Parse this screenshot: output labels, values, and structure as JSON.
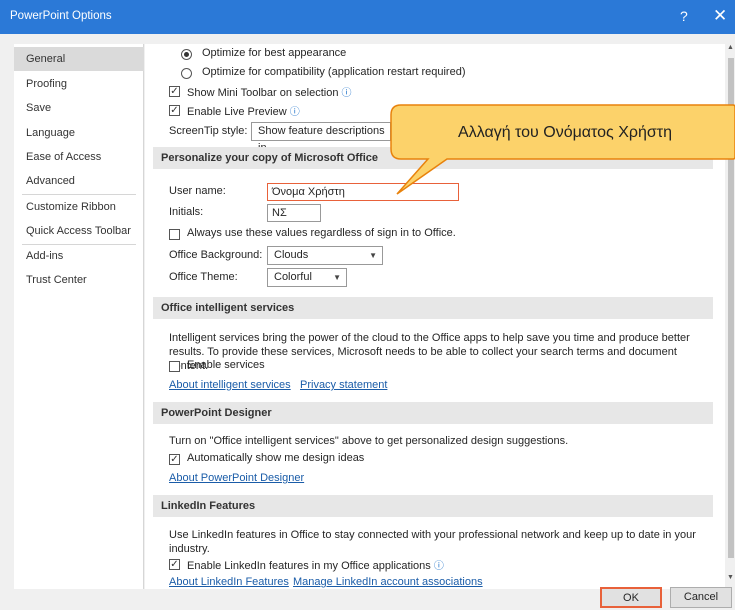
{
  "window": {
    "title": "PowerPoint Options",
    "help": "?",
    "close": "✕"
  },
  "sidebar": {
    "items": [
      {
        "label": "General"
      },
      {
        "label": "Proofing"
      },
      {
        "label": "Save"
      },
      {
        "label": "Language"
      },
      {
        "label": "Ease of Access"
      },
      {
        "label": "Advanced"
      },
      {
        "label": "Customize Ribbon"
      },
      {
        "label": "Quick Access Toolbar"
      },
      {
        "label": "Add-ins"
      },
      {
        "label": "Trust Center"
      }
    ]
  },
  "ui_options": {
    "optimize_best": "Optimize for best appearance",
    "optimize_compat": "Optimize for compatibility (application restart required)",
    "mini_toolbar": "Show Mini Toolbar on selection",
    "live_preview": "Enable Live Preview",
    "screentip_label": "ScreenTip style:",
    "screentip_value": "Show feature descriptions in"
  },
  "personalize": {
    "header": "Personalize your copy of Microsoft Office",
    "user_name_label": "User name:",
    "user_name_value": "Όνομα Χρήστη",
    "initials_label": "Initials:",
    "initials_value": "ΝΣ",
    "always_use": "Always use these values regardless of sign in to Office.",
    "background_label": "Office Background:",
    "background_value": "Clouds",
    "theme_label": "Office Theme:",
    "theme_value": "Colorful"
  },
  "intelligent": {
    "header": "Office intelligent services",
    "description": "Intelligent services bring the power of the cloud to the Office apps to help save you time and produce better results. To provide these services, Microsoft needs to be able to collect your search terms and document content.",
    "enable": "Enable services",
    "about_link": "About intelligent services",
    "privacy_link": "Privacy statement"
  },
  "designer": {
    "header": "PowerPoint Designer",
    "description": "Turn on \"Office intelligent services\" above to get personalized design suggestions.",
    "auto_show": "Automatically show me design ideas",
    "about_link": "About PowerPoint Designer"
  },
  "linkedin": {
    "header": "LinkedIn Features",
    "description": "Use LinkedIn features in Office to stay connected with your professional network and keep up to date in your industry.",
    "enable": "Enable LinkedIn features in my Office applications",
    "about_link": "About LinkedIn Features",
    "manage_link": "Manage LinkedIn account associations"
  },
  "buttons": {
    "ok": "OK",
    "cancel": "Cancel"
  },
  "callout": {
    "text": "Αλλαγή του Ονόματος Χρήστη",
    "fill": "#fcd26a",
    "stroke": "#e8820c"
  },
  "colors": {
    "titlebar": "#2b79d7",
    "highlight_border": "#e8613a",
    "link": "#1a5ca8"
  }
}
